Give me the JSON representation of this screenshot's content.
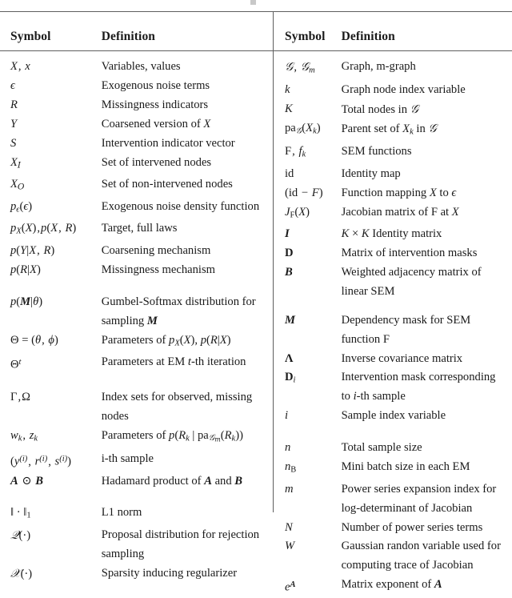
{
  "document": {
    "type": "notation-table",
    "caption_artifact": "",
    "columns": [
      "Symbol",
      "Definition"
    ],
    "rule_color": "#5e5e5e"
  },
  "left_table": {
    "header": {
      "symbol": "Symbol",
      "definition": "Definition"
    },
    "rows": [
      {
        "symbol": "X , x",
        "definition": "Variables, values"
      },
      {
        "symbol": "ϵ",
        "definition": "Exogenous noise terms"
      },
      {
        "symbol": "R",
        "definition": "Missingness indicators"
      },
      {
        "symbol": "Y",
        "definition": "Coarsened version of X"
      },
      {
        "symbol": "S",
        "definition": "Intervention indicator vector"
      },
      {
        "symbol": "Xᴵ",
        "definition": "Set of intervened nodes"
      },
      {
        "symbol": "Xᴼ",
        "definition": "Set of non-intervened nodes"
      },
      {
        "symbol": "pϵ(ϵ)",
        "definition": "Exogenous noise density function"
      },
      {
        "symbol": "pX(X), p(X, R)",
        "definition": "Target, full laws"
      },
      {
        "symbol": "p(Y|X, R)",
        "definition": "Coarsening mechanism"
      },
      {
        "symbol": "p(R|X)",
        "definition": "Missingness mechanism"
      },
      {
        "symbol": "p(M|θ)",
        "definition": "Gumbel-Softmax distribution for sampling M"
      },
      {
        "symbol": "Θ = (θ, ϕ)",
        "definition": "Parameters of pX(X), p(R|X)"
      },
      {
        "symbol": "Θᵗ",
        "definition": "Parameters at EM t-th iteration"
      },
      {
        "symbol": "Γ, Ω",
        "definition": "Index sets for observed, missing nodes"
      },
      {
        "symbol": "wk, zk",
        "definition": "Parameters of p(Rk | pa𝒢m(Rk))"
      },
      {
        "symbol": "(y(i), r(i), s(i))",
        "definition": "i-th sample"
      },
      {
        "symbol": "A ⊙ B",
        "definition": "Hadamard product of A and B"
      },
      {
        "symbol": "‖ · ‖₁",
        "definition": "L1 norm"
      },
      {
        "symbol": "𝒬(·)",
        "definition": "Proposal distribution for rejection sampling"
      },
      {
        "symbol": "𝒳(·)",
        "definition": "Sparsity inducing regularizer"
      }
    ]
  },
  "right_table": {
    "header": {
      "symbol": "Symbol",
      "definition": "Definition"
    },
    "rows": [
      {
        "symbol": "𝒢, 𝒢m",
        "definition": "Graph, m-graph"
      },
      {
        "symbol": "k",
        "definition": "Graph node index variable"
      },
      {
        "symbol": "K",
        "definition": "Total nodes in 𝒢"
      },
      {
        "symbol": "pa𝒢(Xk)",
        "definition": "Parent set of Xk in 𝒢"
      },
      {
        "symbol": "F, fk",
        "definition": "SEM functions"
      },
      {
        "symbol": "id",
        "definition": "Identity map"
      },
      {
        "symbol": "(id − F)",
        "definition": "Function mapping X to ϵ"
      },
      {
        "symbol": "JF(X)",
        "definition": "Jacobian matrix of F at X"
      },
      {
        "symbol": "I",
        "definition": "K × K Identity matrix"
      },
      {
        "symbol": "D",
        "definition": "Matrix of intervention masks"
      },
      {
        "symbol": "B",
        "definition": "Weighted adjacency matrix of linear SEM"
      },
      {
        "symbol": "M",
        "definition": "Dependency mask for SEM function F"
      },
      {
        "symbol": "Λ",
        "definition": "Inverse covariance matrix"
      },
      {
        "symbol": "Di",
        "definition": "Intervention mask corresponding to i-th sample"
      },
      {
        "symbol": "i",
        "definition": "Sample index variable"
      },
      {
        "symbol": "n",
        "definition": "Total sample size"
      },
      {
        "symbol": "nB",
        "definition": "Mini batch size in each EM"
      },
      {
        "symbol": "m",
        "definition": "Power series expansion index for log-determinant of Jacobian"
      },
      {
        "symbol": "N",
        "definition": "Number of power series terms"
      },
      {
        "symbol": "W",
        "definition": "Gaussian randon variable used for computing trace of Jacobian"
      },
      {
        "symbol": "eᴬ",
        "definition": "Matrix exponent of A"
      }
    ]
  }
}
